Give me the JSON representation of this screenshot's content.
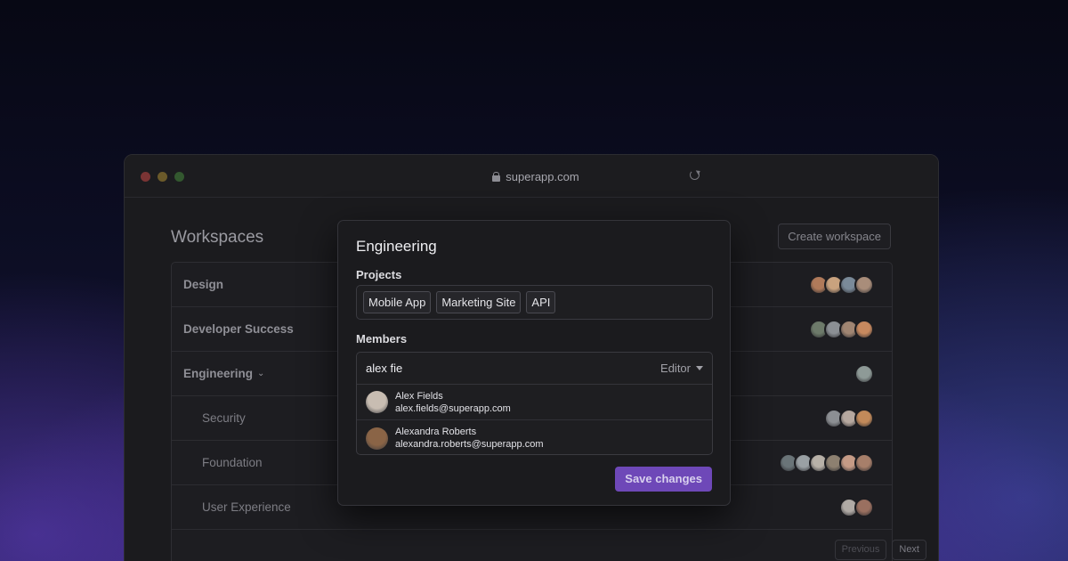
{
  "browser": {
    "url": "superapp.com"
  },
  "page": {
    "title": "Workspaces",
    "create_button": "Create workspace"
  },
  "workspaces": [
    {
      "label": "Design",
      "avatars": [
        "#b07a5a",
        "#c9a27e",
        "#7a8a99",
        "#a98d7a"
      ]
    },
    {
      "label": "Developer Success",
      "avatars": [
        "#6d7a6a",
        "#8b8f94",
        "#a08572",
        "#c7895f"
      ]
    },
    {
      "label": "Engineering",
      "avatars": [
        "#8e9a97"
      ]
    },
    {
      "label": "Security",
      "avatars": [
        "#8c8f93",
        "#b6a89f",
        "#c28a5a"
      ]
    },
    {
      "label": "Foundation",
      "avatars": [
        "#6a7478",
        "#9aa0a4",
        "#b8b1a8",
        "#8d8070",
        "#c59b86",
        "#a77f6a"
      ]
    },
    {
      "label": "User Experience",
      "avatars": [
        "#b0aaa5",
        "#9a7060"
      ]
    }
  ],
  "pagination": {
    "previous": "Previous",
    "next": "Next"
  },
  "modal": {
    "title": "Engineering",
    "projects_label": "Projects",
    "projects": [
      "Mobile App",
      "Marketing Site",
      "API"
    ],
    "members_label": "Members",
    "search_value": "alex fie",
    "role": "Editor",
    "results": [
      {
        "name": "Alex Fields",
        "email": "alex.fields@superapp.com",
        "avatar_color": "#c8bdb2"
      },
      {
        "name": "Alexandra Roberts",
        "email": "alexandra.roberts@superapp.com",
        "avatar_color": "#8a6446"
      }
    ],
    "save_button": "Save changes"
  },
  "colors": {
    "accent": "#6e48b8"
  }
}
